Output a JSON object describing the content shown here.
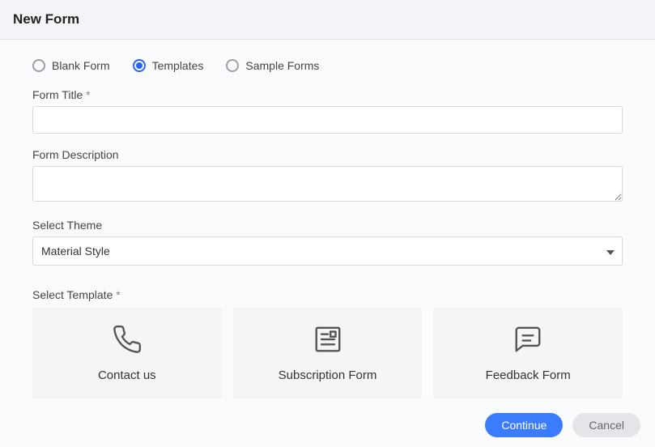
{
  "header": {
    "title": "New Form"
  },
  "radios": {
    "blank": "Blank Form",
    "templates": "Templates",
    "sample": "Sample Forms",
    "selected": "templates"
  },
  "fields": {
    "title_label": "Form Title ",
    "title_req": "*",
    "title_value": "",
    "desc_label": "Form Description",
    "desc_value": "",
    "theme_label": "Select Theme",
    "theme_value": "Material Style",
    "template_label": "Select Template ",
    "template_req": "*"
  },
  "templates": {
    "contact": "Contact us",
    "subscription": "Subscription Form",
    "feedback": "Feedback Form"
  },
  "footer": {
    "continue": "Continue",
    "cancel": "Cancel"
  }
}
